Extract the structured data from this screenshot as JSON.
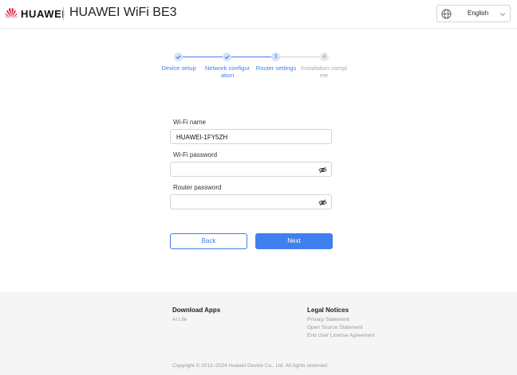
{
  "header": {
    "brand": "HUAWEI",
    "product": "HUAWEI WiFi BE3",
    "language": "English",
    "logo_icon": "huawei-petal-logo",
    "brand_color": "#cf0a2c"
  },
  "steps": [
    {
      "number": "1",
      "label_lines": [
        "Device setup"
      ],
      "state": "done"
    },
    {
      "number": "2",
      "label_lines": [
        "Network configur",
        "ation"
      ],
      "state": "done"
    },
    {
      "number": "3",
      "label_lines": [
        "Router settings"
      ],
      "state": "current"
    },
    {
      "number": "4",
      "label_lines": [
        "Installation compl",
        "ete"
      ],
      "state": "todo"
    }
  ],
  "form": {
    "wifi_name_label": "Wi-Fi name",
    "wifi_name_value": "HUAWEI-1FY5ZH",
    "wifi_password_label": "Wi-Fi password",
    "wifi_password_value": "",
    "router_password_label": "Router password",
    "router_password_value": ""
  },
  "buttons": {
    "back": "Back",
    "next": "Next"
  },
  "footer": {
    "download_title": "Download Apps",
    "download_links": [
      "AI Life"
    ],
    "legal_title": "Legal Notices",
    "legal_links": [
      "Privacy Statement",
      "Open Source Statement",
      "End User License Agreement"
    ],
    "copyright": "Copyright © 2012–2024 Huawei Device Co., Ltd. All rights reserved."
  },
  "colors": {
    "accent": "#3f7fee",
    "accent_light": "#d6e4fb",
    "footer_bg": "#f5f5f5"
  }
}
